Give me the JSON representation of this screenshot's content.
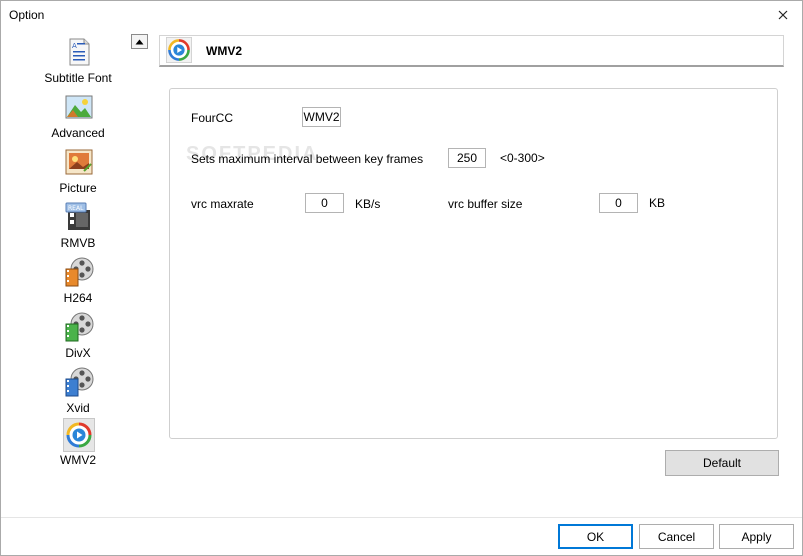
{
  "window": {
    "title": "Option"
  },
  "categories": [
    {
      "label": "Subtitle Font",
      "icon": "subtitle-font-icon"
    },
    {
      "label": "Advanced",
      "icon": "advanced-icon"
    },
    {
      "label": "Picture",
      "icon": "picture-icon"
    },
    {
      "label": "RMVB",
      "icon": "rmvb-icon"
    },
    {
      "label": "H264",
      "icon": "h264-film-reel-icon"
    },
    {
      "label": "DivX",
      "icon": "divx-film-reel-icon"
    },
    {
      "label": "Xvid",
      "icon": "xvid-film-reel-icon"
    },
    {
      "label": "WMV2",
      "icon": "wmv2-play-icon",
      "selected": true
    }
  ],
  "header": {
    "title": "WMV2"
  },
  "settings": {
    "fourcc_label": "FourCC",
    "fourcc_value": "WMV2",
    "keyframe_label": "Sets maximum interval between key frames",
    "keyframe_value": "250",
    "keyframe_range": "<0-300>",
    "vrc_maxrate_label": "vrc maxrate",
    "vrc_maxrate_value": "0",
    "vrc_maxrate_unit": "KB/s",
    "vrc_buffer_label": "vrc buffer size",
    "vrc_buffer_value": "0",
    "vrc_buffer_unit": "KB"
  },
  "watermark": "SOFTPEDIA",
  "buttons": {
    "default": "Default",
    "ok": "OK",
    "cancel": "Cancel",
    "apply": "Apply"
  },
  "colors": {
    "accent": "#0078d7",
    "panel_border": "#cfcfcf",
    "button_face": "#e1e1e1"
  }
}
